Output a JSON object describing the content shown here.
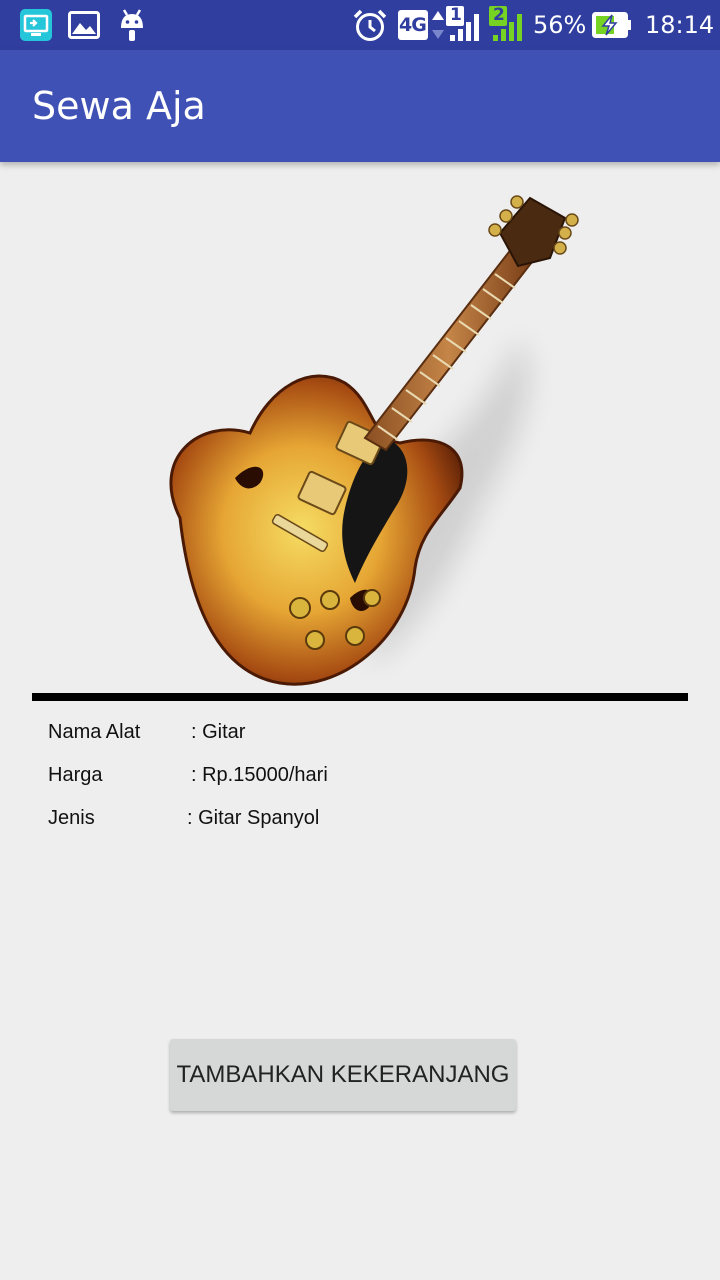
{
  "status_bar": {
    "network_type": "4G",
    "sim1_label": "1",
    "sim2_label": "2",
    "battery_percent": "56%",
    "time": "18:14",
    "icons": [
      "screen-mirror-icon",
      "gallery-icon",
      "android-debug-icon",
      "alarm-icon",
      "network-4g-icon",
      "signal-sim1-icon",
      "signal-sim2-icon",
      "battery-charging-icon"
    ]
  },
  "app_bar": {
    "title": "Sewa Aja"
  },
  "product": {
    "image": "guitar-image",
    "rows": [
      {
        "label": "Nama Alat",
        "value": ": Gitar"
      },
      {
        "label": "Harga",
        "value": ": Rp.15000/hari"
      },
      {
        "label": "Jenis",
        "value": ": Gitar Spanyol"
      }
    ]
  },
  "actions": {
    "add_to_cart_label": "TAMBAHKAN KEKERANJANG"
  },
  "colors": {
    "status_bar": "#303f9f",
    "app_bar": "#3f51b5",
    "background": "#eeeeee",
    "button": "#d6d7d7"
  }
}
